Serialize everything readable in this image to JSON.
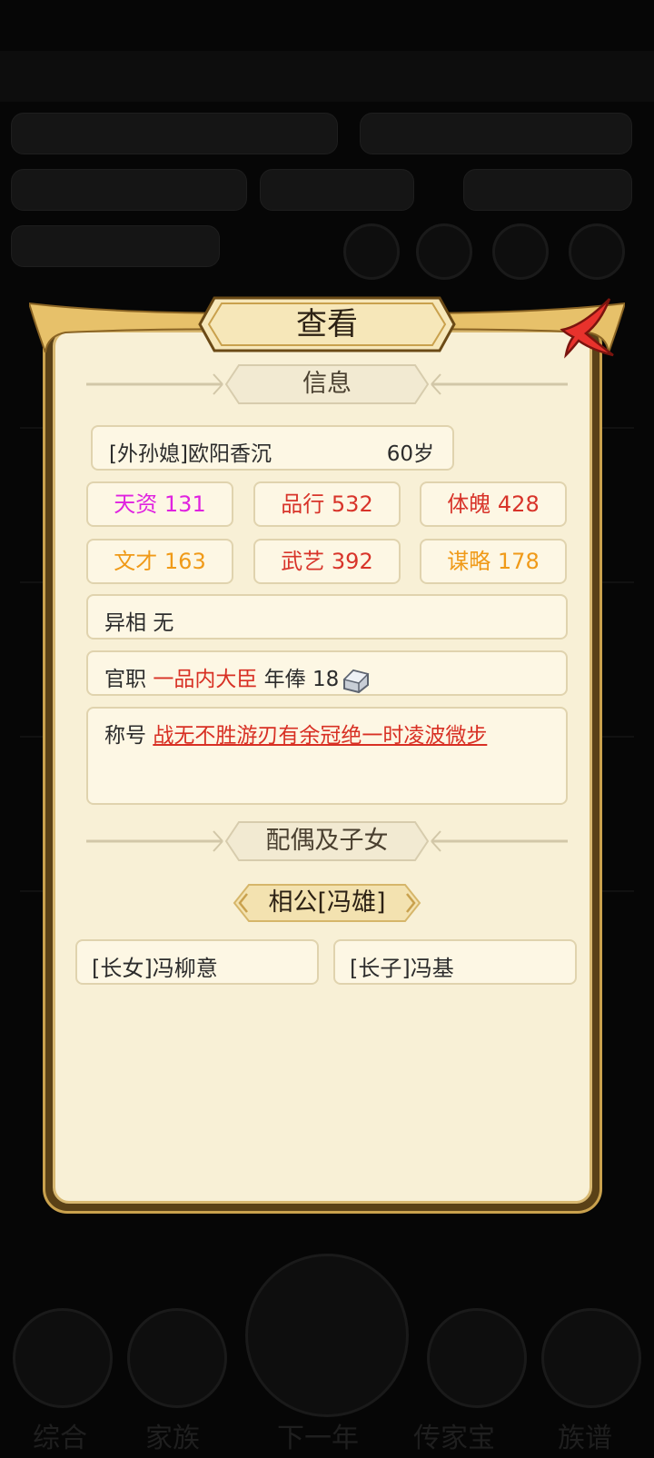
{
  "dialog": {
    "title": "查看",
    "section_info": "信息",
    "section_family": "配偶及子女"
  },
  "person": {
    "name": "[外孙媳]欧阳香沉",
    "age": "60岁"
  },
  "stats": [
    {
      "label": "天资 131",
      "color": "#e022e0"
    },
    {
      "label": "品行 532",
      "color": "#d8342a"
    },
    {
      "label": "体魄 428",
      "color": "#d8342a"
    },
    {
      "label": "文才 163",
      "color": "#f09a18"
    },
    {
      "label": "武艺 392",
      "color": "#d8342a"
    },
    {
      "label": "谋略 178",
      "color": "#f09a18"
    }
  ],
  "traits": {
    "label": "异相",
    "value": "无"
  },
  "office": {
    "label": "官职",
    "rank": "一品内大臣",
    "salary_label": "年俸",
    "salary": "18",
    "salary_icon": "silver-ingot-icon"
  },
  "titles": {
    "label": "称号",
    "value": "战无不胜游刃有余冠绝一时凌波微步"
  },
  "spouse": {
    "label": "相公[冯雄]"
  },
  "children": [
    {
      "label": "[长女]冯柳意"
    },
    {
      "label": "[长子]冯基"
    }
  ],
  "background": {
    "pills": [
      "",
      "",
      "",
      "",
      "",
      ""
    ],
    "nav": [
      "综合",
      "家族",
      "下一年",
      "传家宝",
      "族谱"
    ]
  }
}
